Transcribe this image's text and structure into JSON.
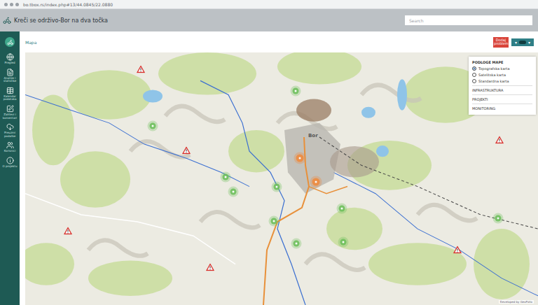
{
  "browser": {
    "url": "bo.tbox.rs/index.php#13/44.0845/22.0880"
  },
  "header": {
    "title": "Kreči se održivo-Bor na dva točka",
    "search_placeholder": "Search"
  },
  "sidebar": {
    "items": [
      {
        "label": "Pregled"
      },
      {
        "label": "Analize i statistike"
      },
      {
        "label": "Kalendar podataka"
      },
      {
        "label": "Zahtevi i komentari"
      },
      {
        "label": "Preuzmi podatke"
      },
      {
        "label": "Korisnici"
      },
      {
        "label": "O projektu"
      }
    ]
  },
  "page": {
    "breadcrumb": "Mapa"
  },
  "actions": {
    "add_button": "Dodaj problem",
    "filter_left": "▾",
    "filter_right": "▾"
  },
  "map": {
    "town_label": "Bor",
    "attribution": "Developed by GeoFolio",
    "markers": [
      {
        "kind": "point",
        "color": "#6cbf5a"
      },
      {
        "kind": "point",
        "color": "#6cbf5a"
      },
      {
        "kind": "point",
        "color": "#6cbf5a"
      },
      {
        "kind": "point",
        "color": "#6cbf5a"
      },
      {
        "kind": "point",
        "color": "#6cbf5a"
      },
      {
        "kind": "point",
        "color": "#6cbf5a"
      },
      {
        "kind": "point",
        "color": "#6cbf5a"
      },
      {
        "kind": "point",
        "color": "#6cbf5a"
      },
      {
        "kind": "point",
        "color": "#6cbf5a"
      },
      {
        "kind": "point",
        "color": "#6cbf5a"
      },
      {
        "kind": "cluster",
        "color": "#f08a3c"
      },
      {
        "kind": "cluster",
        "color": "#f08a3c"
      },
      {
        "kind": "warning",
        "color": "#d9302c"
      },
      {
        "kind": "warning",
        "color": "#d9302c"
      },
      {
        "kind": "warning",
        "color": "#d9302c"
      },
      {
        "kind": "warning",
        "color": "#d9302c"
      },
      {
        "kind": "warning",
        "color": "#d9302c"
      },
      {
        "kind": "warning",
        "color": "#d9302c"
      }
    ]
  },
  "layers_panel": {
    "title": "PODLOGE MAPE",
    "basemaps": [
      {
        "label": "Topografska karta",
        "selected": true
      },
      {
        "label": "Satelitska karta",
        "selected": false
      },
      {
        "label": "Standardna karta",
        "selected": false
      }
    ],
    "sections": [
      "INFRASTRUKTURA",
      "PROJEKTI",
      "MONITORING"
    ]
  }
}
